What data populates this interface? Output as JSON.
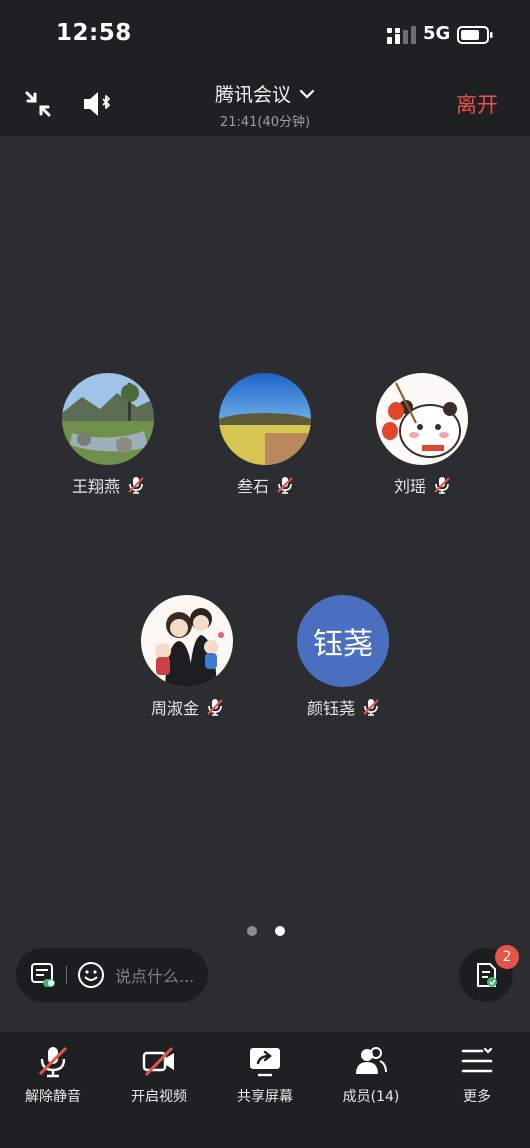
{
  "status_bar": {
    "time": "12:58",
    "network": "5G"
  },
  "header": {
    "title": "腾讯会议",
    "subtitle": "21:41(40分钟)",
    "leave_label": "离开"
  },
  "participants": [
    {
      "name": "王翔燕",
      "mic_muted": true
    },
    {
      "name": "叁石",
      "mic_muted": true
    },
    {
      "name": "刘瑶",
      "mic_muted": true
    },
    {
      "name": "周淑金",
      "mic_muted": true
    },
    {
      "name": "颜钰荛",
      "avatar_text": "钰荛",
      "mic_muted": true
    }
  ],
  "pager": {
    "pages": 2,
    "active": 2
  },
  "chat": {
    "placeholder": "说点什么..."
  },
  "notes": {
    "badge_count": "2"
  },
  "toolbar": {
    "unmute_label": "解除静音",
    "video_label": "开启视频",
    "share_label": "共享屏幕",
    "members_label": "成员(14)",
    "more_label": "更多"
  },
  "colors": {
    "leave": "#e8524a",
    "badge": "#e5544a",
    "initials_bg": "#4a6fbf"
  }
}
